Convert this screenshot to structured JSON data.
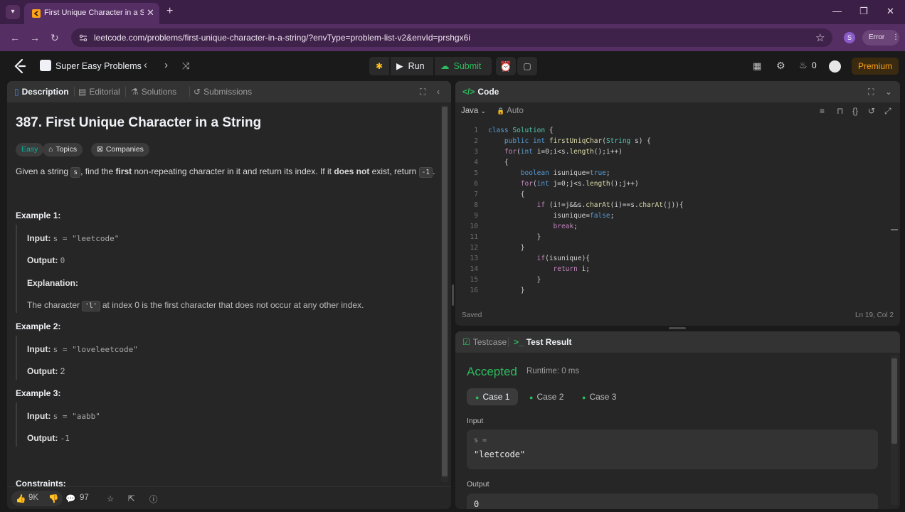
{
  "browser": {
    "tab_title": "First Unique Character in a Str",
    "url": "leetcode.com/problems/first-unique-character-in-a-string/?envType=problem-list-v2&envId=prshgx6i",
    "profile_initial": "S",
    "error_label": "Error"
  },
  "nav": {
    "list_title": "Super Easy Problems",
    "run_label": "Run",
    "submit_label": "Submit",
    "fire_count": "0",
    "premium_label": "Premium"
  },
  "left_tabs": [
    "Description",
    "Editorial",
    "Solutions",
    "Submissions"
  ],
  "problem": {
    "title": "387. First Unique Character in a String",
    "difficulty": "Easy",
    "topics_label": "Topics",
    "companies_label": "Companies",
    "desc_a": "Given a string ",
    "desc_s": "s",
    "desc_b": ", find the ",
    "desc_first": "first",
    "desc_c": " non-repeating character in it and return its index. If it ",
    "desc_notexist": "does not",
    "desc_d": " exist, return ",
    "desc_neg": "-1",
    "desc_e": "."
  },
  "examples": [
    {
      "title": "Example 1:",
      "input_label": "Input:",
      "input": "s = \"leetcode\"",
      "output_label": "Output:",
      "output": "0",
      "explanation_label": "Explanation:",
      "expl_a": "The character ",
      "expl_code": "'l'",
      "expl_b": " at index 0 is the first character that does not occur at any other index."
    },
    {
      "title": "Example 2:",
      "input_label": "Input:",
      "input": "s = \"loveleetcode\"",
      "output_label": "Output:",
      "output": "2"
    },
    {
      "title": "Example 3:",
      "input_label": "Input:",
      "input": "s = \"aabb\"",
      "output_label": "Output:",
      "output": "-1"
    }
  ],
  "constraints_label": "Constraints:",
  "footer": {
    "likes": "9K",
    "comments": "97"
  },
  "code_panel": {
    "title": "Code",
    "language": "Java",
    "auto_label": "Auto",
    "status_left": "Saved",
    "status_right": "Ln 19, Col 2"
  },
  "code_lines": [
    "class Solution {",
    "    public int firstUniqChar(String s) {",
    "    for(int i=0;i<s.length();i++)",
    "    {",
    "        boolean isunique=true;",
    "        for(int j=0;j<s.length();j++)",
    "        {",
    "            if (i!=j&&s.charAt(i)==s.charAt(j)){",
    "                isunique=false;",
    "                break;",
    "            }",
    "        }",
    "            if(isunique){",
    "                return i;",
    "            }",
    "        }"
  ],
  "result": {
    "tab_testcase": "Testcase",
    "tab_result": "Test Result",
    "status": "Accepted",
    "runtime": "Runtime: 0 ms",
    "cases": [
      "Case 1",
      "Case 2",
      "Case 3"
    ],
    "input_label": "Input",
    "input_var": "s =",
    "input_value": "\"leetcode\"",
    "output_label": "Output",
    "output_value": "0"
  },
  "colors": {
    "accent_green": "#2cbb5d",
    "premium": "#ffa116",
    "browser_purple": "#552f63"
  }
}
